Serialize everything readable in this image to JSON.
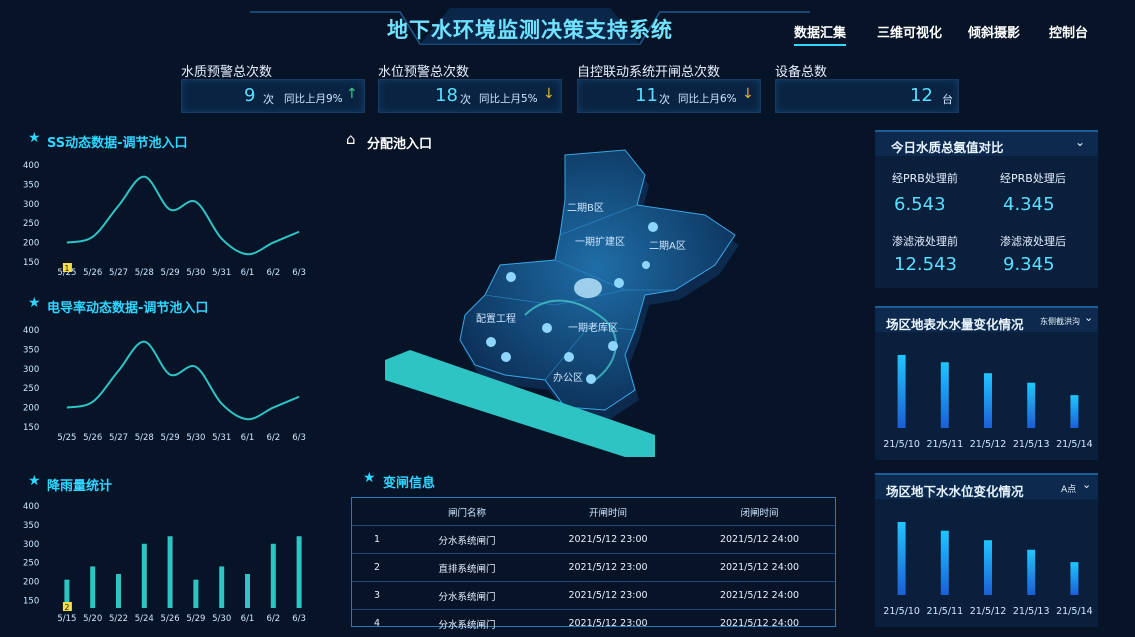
{
  "header": {
    "title": "地下水环境监测决策支持系统",
    "nav": [
      "数据汇集",
      "三维可视化",
      "倾斜摄影",
      "控制台"
    ],
    "active_nav": "数据汇集"
  },
  "stats": [
    {
      "label": "水质预警总次数",
      "value": "9",
      "unit": "次",
      "compare": "同比上月9%",
      "trend": "up"
    },
    {
      "label": "水位预警总次数",
      "value": "18",
      "unit": "次",
      "compare": "同比上月5%",
      "trend": "down"
    },
    {
      "label": "自控联动系统开闸总次数",
      "value": "11",
      "unit": "次",
      "compare": "同比上月6%",
      "trend": "down"
    },
    {
      "label": "设备总数",
      "value": "12",
      "unit": "台",
      "compare": "",
      "trend": ""
    }
  ],
  "left": {
    "ss_title": "SS动态数据-调节池入口",
    "cond_title": "电导率动态数据-调节池入口",
    "rain_title": "降雨量统计",
    "ss_badge": "1",
    "rain_badge": "2"
  },
  "map": {
    "title": "分配池入口",
    "labels": [
      "二期B区",
      "一期扩建区",
      "二期A区",
      "配置工程",
      "一期老库区",
      "办公区"
    ]
  },
  "gates": {
    "title": "变闸信息",
    "headers": [
      "",
      "闸门名称",
      "开闸时间",
      "闭闸时间"
    ],
    "rows": [
      [
        "1",
        "分水系统闸门",
        "2021/5/12 23:00",
        "2021/5/12 24:00"
      ],
      [
        "2",
        "直排系统闸门",
        "2021/5/12 23:00",
        "2021/5/12 24:00"
      ],
      [
        "3",
        "分水系统闸门",
        "2021/5/12 23:00",
        "2021/5/12 24:00"
      ],
      [
        "4",
        "分水系统闸门",
        "2021/5/12 23:00",
        "2021/5/12 24:00"
      ]
    ]
  },
  "right": {
    "wq_title": "今日水质总氨值对比",
    "wq": [
      {
        "label": "经PRB处理前",
        "value": "6.543"
      },
      {
        "label": "经PRB处理后",
        "value": "4.345"
      },
      {
        "label": "渗滤液处理前",
        "value": "12.543"
      },
      {
        "label": "渗滤液处理后",
        "value": "9.345"
      }
    ],
    "surface_title": "场区地表水水量变化情况",
    "surface_select": "东侧截洪沟",
    "ground_title": "场区地下水水位变化情况",
    "ground_select": "A点"
  },
  "colors": {
    "accent": "#2fd6ff",
    "bg": "#071428",
    "teal": "#2ec4c4",
    "bar_top": "#21c6ff",
    "bar_bottom": "#1a5fd6"
  },
  "chart_data": [
    {
      "type": "line",
      "title": "SS动态数据-调节池入口",
      "categories": [
        "5/25",
        "5/26",
        "5/27",
        "5/28",
        "5/29",
        "5/30",
        "5/31",
        "6/1",
        "6/2",
        "6/3"
      ],
      "values": [
        200,
        215,
        295,
        370,
        285,
        305,
        210,
        170,
        200,
        228
      ],
      "ylim": [
        150,
        400
      ],
      "yticks": [
        150,
        200,
        250,
        300,
        350,
        400
      ]
    },
    {
      "type": "line",
      "title": "电导率动态数据-调节池入口",
      "categories": [
        "5/25",
        "5/26",
        "5/27",
        "5/28",
        "5/29",
        "5/30",
        "5/31",
        "6/1",
        "6/2",
        "6/3"
      ],
      "values": [
        200,
        215,
        295,
        370,
        285,
        305,
        210,
        170,
        200,
        228
      ],
      "ylim": [
        150,
        400
      ],
      "yticks": [
        150,
        200,
        250,
        300,
        350,
        400
      ]
    },
    {
      "type": "bar",
      "title": "降雨量统计",
      "categories": [
        "5/15",
        "5/20",
        "5/22",
        "5/24",
        "5/26",
        "5/29",
        "5/30",
        "6/1",
        "6/2",
        "6/3"
      ],
      "values": [
        205,
        240,
        220,
        300,
        320,
        205,
        240,
        220,
        300,
        320
      ],
      "ylim": [
        130,
        400
      ],
      "yticks": [
        150,
        200,
        250,
        300,
        350,
        400
      ]
    },
    {
      "type": "bar",
      "title": "场区地表水水量变化情况",
      "categories": [
        "21/5/10",
        "21/5/11",
        "21/5/12",
        "21/5/13",
        "21/5/14"
      ],
      "values": [
        100,
        90,
        75,
        62,
        45
      ],
      "ylim": [
        0,
        115
      ]
    },
    {
      "type": "bar",
      "title": "场区地下水水位变化情况",
      "categories": [
        "21/5/10",
        "21/5/11",
        "21/5/12",
        "21/5/13",
        "21/5/14"
      ],
      "values": [
        100,
        88,
        75,
        62,
        45
      ],
      "ylim": [
        0,
        115
      ]
    }
  ]
}
